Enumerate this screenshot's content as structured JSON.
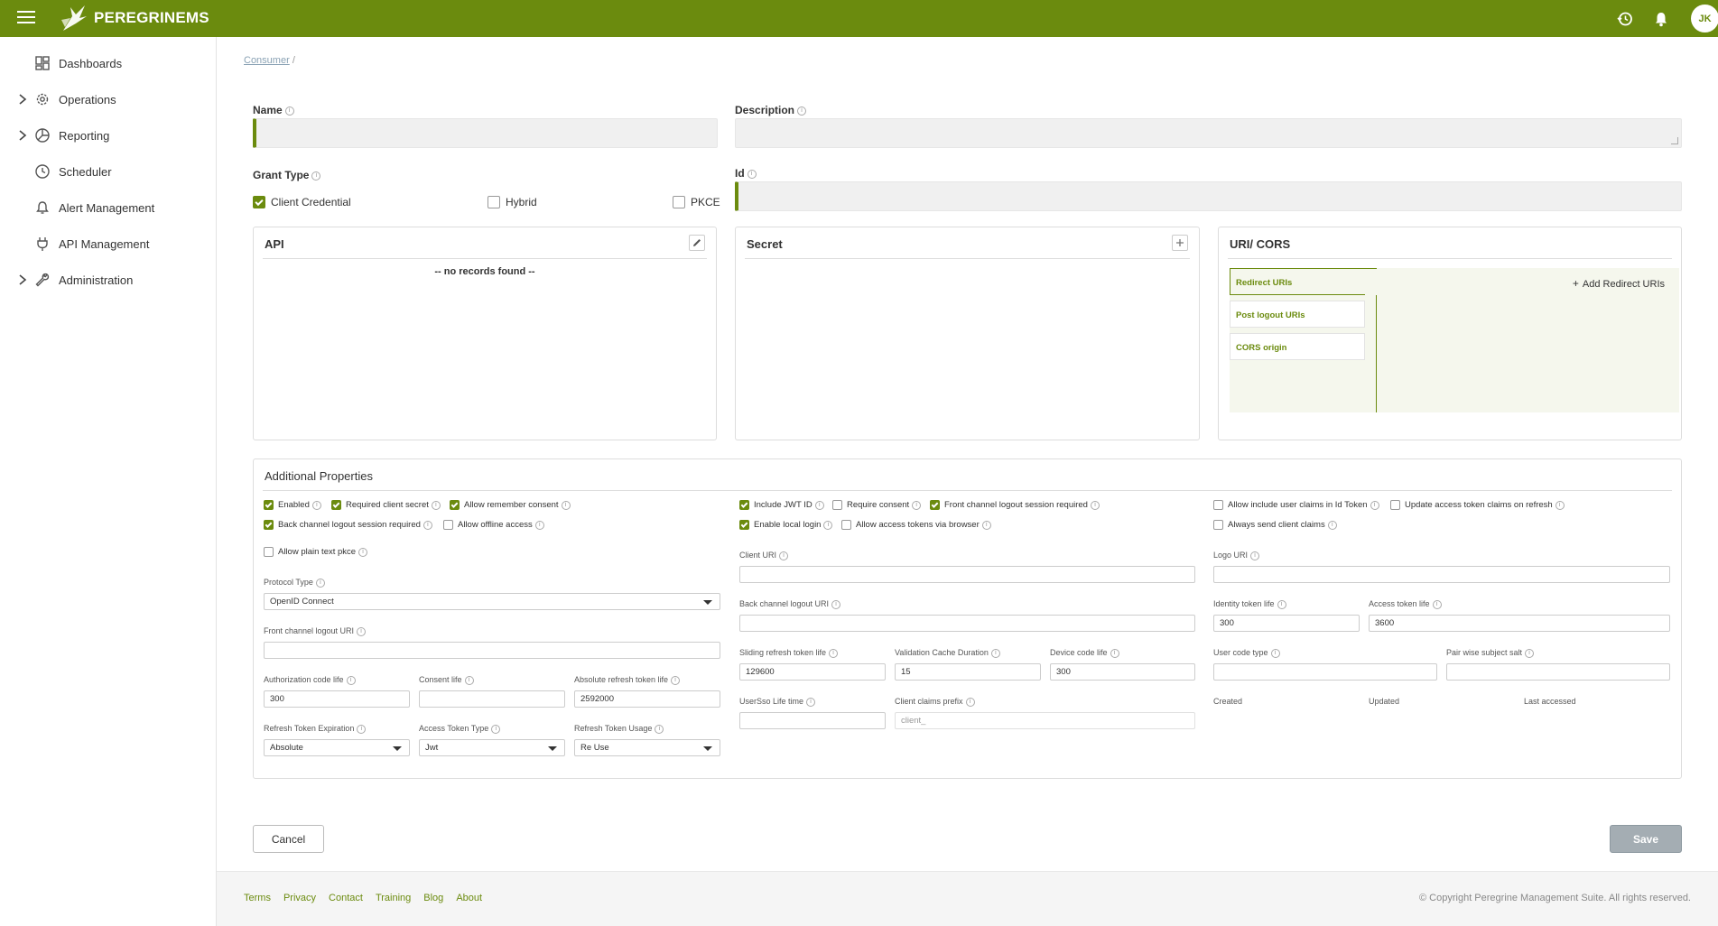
{
  "app": {
    "logo_text": "PEREGRINEMS",
    "user_initials": "JK"
  },
  "sidebar": {
    "items": [
      {
        "label": "Dashboards",
        "expandable": false,
        "icon": "dashboard-icon"
      },
      {
        "label": "Operations",
        "expandable": true,
        "icon": "gear-icon"
      },
      {
        "label": "Reporting",
        "expandable": true,
        "icon": "pie-chart-icon"
      },
      {
        "label": "Scheduler",
        "expandable": false,
        "icon": "clock-icon"
      },
      {
        "label": "Alert Management",
        "expandable": false,
        "icon": "bell-icon"
      },
      {
        "label": "API Management",
        "expandable": false,
        "icon": "plug-icon"
      },
      {
        "label": "Administration",
        "expandable": true,
        "icon": "wrench-icon"
      }
    ]
  },
  "breadcrumb": {
    "link": "Consumer",
    "separator": "/"
  },
  "form": {
    "name_label": "Name",
    "description_label": "Description",
    "grant_type_label": "Grant Type",
    "id_label": "Id",
    "grant_types": [
      {
        "label": "Client Credential",
        "checked": true
      },
      {
        "label": "Hybrid",
        "checked": false
      },
      {
        "label": "PKCE",
        "checked": false
      }
    ]
  },
  "api_panel": {
    "title": "API",
    "empty_text": "-- no records found --"
  },
  "secret_panel": {
    "title": "Secret"
  },
  "uri_panel": {
    "title": "URI/ CORS",
    "tabs": [
      "Redirect URIs",
      "Post logout URIs",
      "CORS origin"
    ],
    "add_label": "Add Redirect URIs"
  },
  "additional": {
    "title": "Additional Properties",
    "checkboxes": [
      {
        "label": "Enabled",
        "checked": true
      },
      {
        "label": "Required client secret",
        "checked": true
      },
      {
        "label": "Allow remember consent",
        "checked": true
      },
      {
        "label": "Include JWT ID",
        "checked": true
      },
      {
        "label": "Require consent",
        "checked": false
      },
      {
        "label": "Front channel logout session required",
        "checked": true
      },
      {
        "label": "Allow include user claims in Id Token",
        "checked": false
      },
      {
        "label": "Update access token claims on refresh",
        "checked": false
      },
      {
        "label": "Back channel logout session required",
        "checked": true
      },
      {
        "label": "Allow offline access",
        "checked": false
      },
      {
        "label": "Enable local login",
        "checked": true
      },
      {
        "label": "Allow access tokens via browser",
        "checked": false
      },
      {
        "label": "Always send client claims",
        "checked": false
      },
      {
        "label": "Allow plain text pkce",
        "checked": false
      }
    ],
    "fields": {
      "protocol_type": {
        "label": "Protocol Type",
        "value": "OpenID Connect"
      },
      "front_channel_logout_uri": {
        "label": "Front channel logout URI",
        "value": ""
      },
      "authorization_code_life": {
        "label": "Authorization code life",
        "value": "300"
      },
      "consent_life": {
        "label": "Consent life",
        "value": ""
      },
      "absolute_refresh_token_life": {
        "label": "Absolute refresh token life",
        "value": "2592000"
      },
      "refresh_token_expiration": {
        "label": "Refresh Token Expiration",
        "value": "Absolute"
      },
      "access_token_type": {
        "label": "Access Token Type",
        "value": "Jwt"
      },
      "refresh_token_usage": {
        "label": "Refresh Token Usage",
        "value": "Re Use"
      },
      "client_uri": {
        "label": "Client URI",
        "value": ""
      },
      "back_channel_logout_uri": {
        "label": "Back channel logout URI",
        "value": ""
      },
      "sliding_refresh_token_life": {
        "label": "Sliding refresh token life",
        "value": "129600"
      },
      "validation_cache_duration": {
        "label": "Validation Cache Duration",
        "value": "15"
      },
      "device_code_life": {
        "label": "Device code life",
        "value": "300"
      },
      "usersso_life_time": {
        "label": "UserSso Life time",
        "value": ""
      },
      "client_claims_prefix": {
        "label": "Client claims prefix",
        "placeholder": "client_"
      },
      "logo_uri": {
        "label": "Logo URI",
        "value": ""
      },
      "identity_token_life": {
        "label": "Identity token life",
        "value": "300"
      },
      "access_token_life": {
        "label": "Access token life",
        "value": "3600"
      },
      "user_code_type": {
        "label": "User code type",
        "value": ""
      },
      "pair_wise_subject_salt": {
        "label": "Pair wise subject salt",
        "value": ""
      },
      "created": {
        "label": "Created"
      },
      "updated": {
        "label": "Updated"
      },
      "last_accessed": {
        "label": "Last accessed"
      }
    }
  },
  "actions": {
    "cancel": "Cancel",
    "save": "Save"
  },
  "footer": {
    "links": [
      "Terms",
      "Privacy",
      "Contact",
      "Training",
      "Blog",
      "About"
    ],
    "copyright": "© Copyright Peregrine Management Suite. All rights reserved."
  },
  "colors": {
    "brand": "#6b8b0e",
    "save_disabled": "#a4adb3"
  }
}
